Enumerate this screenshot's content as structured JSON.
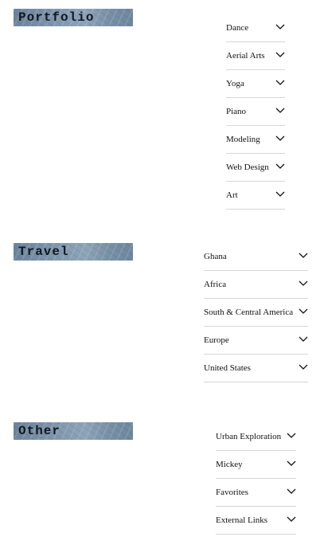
{
  "portfolio": {
    "title": "Portfolio",
    "items": [
      {
        "label": "Dance"
      },
      {
        "label": "Aerial Arts"
      },
      {
        "label": "Yoga"
      },
      {
        "label": "Piano"
      },
      {
        "label": "Modeling"
      },
      {
        "label": "Web Design"
      },
      {
        "label": "Art"
      }
    ]
  },
  "travel": {
    "title": "Travel",
    "items": [
      {
        "label": "Ghana"
      },
      {
        "label": "Africa"
      },
      {
        "label": "South & Central America"
      },
      {
        "label": "Europe"
      },
      {
        "label": "United States"
      }
    ]
  },
  "other": {
    "title": "Other",
    "items": [
      {
        "label": "Urban Exploration"
      },
      {
        "label": "Mickey"
      },
      {
        "label": "Favorites"
      },
      {
        "label": "External Links"
      }
    ]
  },
  "icons": {
    "expand": "chevron-down-icon"
  },
  "colors": {
    "banner": "#7f97ad",
    "divider": "#d6d6d6",
    "text": "#111111"
  }
}
